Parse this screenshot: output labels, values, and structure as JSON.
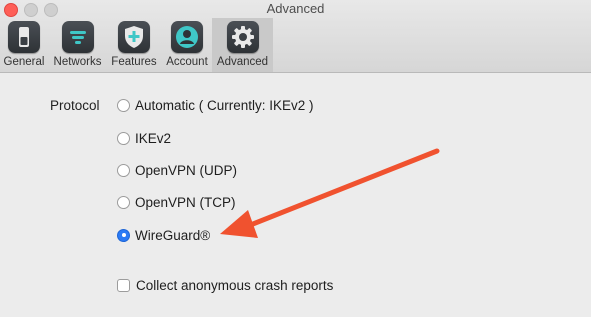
{
  "window": {
    "title": "Advanced"
  },
  "tabs": [
    {
      "label": "General",
      "icon": "general-switch-icon"
    },
    {
      "label": "Networks",
      "icon": "networks-wifi-icon"
    },
    {
      "label": "Features",
      "icon": "features-shield-icon"
    },
    {
      "label": "Account",
      "icon": "account-person-icon"
    },
    {
      "label": "Advanced",
      "icon": "advanced-gear-icon",
      "selected": true
    }
  ],
  "protocol": {
    "label": "Protocol",
    "options": [
      {
        "label": "Automatic ( Currently: IKEv2 )",
        "selected": false
      },
      {
        "label": "IKEv2",
        "selected": false
      },
      {
        "label": "OpenVPN (UDP)",
        "selected": false
      },
      {
        "label": "OpenVPN (TCP)",
        "selected": false
      },
      {
        "label": "WireGuard®",
        "selected": true
      }
    ]
  },
  "crash_reports": {
    "label": "Collect anonymous crash reports",
    "checked": false
  },
  "colors": {
    "accent": "#2a7af5",
    "annotation_arrow": "#f0522f"
  }
}
